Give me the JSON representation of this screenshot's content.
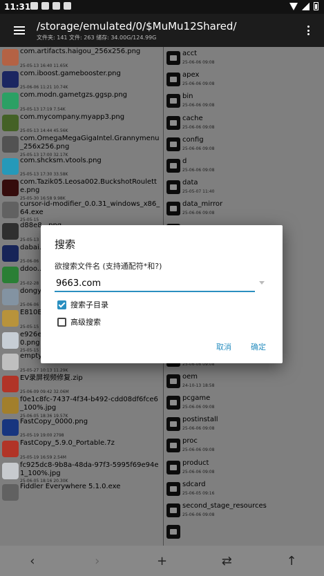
{
  "status_bar": {
    "time": "11:31"
  },
  "header": {
    "path": "/storage/emulated/0/$MuMu12Shared/",
    "stats": "文件夹: 141  文件: 263  储存: 34.00G/124.99G"
  },
  "left_files": [
    {
      "name": "com.artifacts.haigou_256x256.png",
      "meta": "25-05-13 16:40  11.65K",
      "color": "#c46b4a"
    },
    {
      "name": "com.iboost.gamebooster.png",
      "meta": "25-06-06 11:21  10.74K",
      "color": "#1e2a6a"
    },
    {
      "name": "com.modn.gametgzs.ggsp.png",
      "meta": "25-05-13 17:19  7.54K",
      "color": "#2fae6d"
    },
    {
      "name": "com.mycompany.myapp3.png",
      "meta": "25-05-13 14:44  45.56K",
      "color": "#4a6a2a"
    },
    {
      "name": "com.OmegaMegaGigaIntel.Grannymenu_256x256.png",
      "meta": "25-05-13 17:00  32.17K",
      "color": "#5a5a5a"
    },
    {
      "name": "com.shcksm.vtools.png",
      "meta": "25-05-13 17:30  33.58K",
      "color": "#2aa6c9"
    },
    {
      "name": "com.Tazik05.Leosa002.BuckshotRoulette.png",
      "meta": "25-05-30 16:58  9.98K",
      "color": "#3a0e0e"
    },
    {
      "name": "cursor-id-modifier_0.0.31_windows_x86_64.exe",
      "meta": "25-05-15",
      "color": "#6a6a6a"
    },
    {
      "name": "d88e8...png",
      "meta": "25-05-13",
      "color": "#333"
    },
    {
      "name": "dabai...",
      "meta": "25-06-06",
      "color": "#1a2860"
    },
    {
      "name": "ddoo...",
      "meta": "25-02-28",
      "color": "#2e8a3a"
    },
    {
      "name": "dongy...",
      "meta": "25-06-06",
      "color": "#8fa0b0"
    },
    {
      "name": "E810B...",
      "meta": "25-05-15",
      "color": "#c8a040"
    },
    {
      "name": "e926e20f-c6a7-4725-a5ef-b2d7850cfcd0.png",
      "meta": "25-05-15 19:54  1.36K",
      "color": "#d8e0e8"
    },
    {
      "name": "empty.png",
      "meta": "25-05-27 10:13  11.29K",
      "color": "#d0d0d0"
    },
    {
      "name": "EV录屏视频修复.zip",
      "meta": "25-06-09 09:42  32.06M",
      "color": "#c0392b"
    },
    {
      "name": "f0e1c8fc-7437-4f34-b492-cdd08df6fce6_100%.jpg",
      "meta": "25-06-05 18:36  19.57K",
      "color": "#b08a30"
    },
    {
      "name": "FastCopy_0000.png",
      "meta": "25-05-19 19:00  2798",
      "color": "#1a3a8a"
    },
    {
      "name": "FastCopy_5.9.0_Portable.7z",
      "meta": "25-05-19 16:59  2.54M",
      "color": "#c0392b"
    },
    {
      "name": "fc925dc8-9b8a-48da-97f3-5995f69e94e1_100%.jpg",
      "meta": "25-06-05 18:16  20.30K",
      "color": "#d8dce0"
    },
    {
      "name": "Fiddler Everywhere 5.1.0.exe",
      "meta": "",
      "color": "#6a6a6a"
    }
  ],
  "right_folders": [
    {
      "name": "acct",
      "meta": "25-06-06 09:08"
    },
    {
      "name": "apex",
      "meta": "25-06-06 09:08"
    },
    {
      "name": "bin",
      "meta": "25-06-06 09:08"
    },
    {
      "name": "cache",
      "meta": "25-06-06 09:08"
    },
    {
      "name": "config",
      "meta": "25-06-06 09:08"
    },
    {
      "name": "d",
      "meta": "25-06-06 09:08"
    },
    {
      "name": "data",
      "meta": "25-05-07 11:40"
    },
    {
      "name": "data_mirror",
      "meta": "25-06-06 09:08"
    },
    {
      "name": "",
      "meta": ""
    },
    {
      "name": "",
      "meta": ""
    },
    {
      "name": "",
      "meta": ""
    },
    {
      "name": "",
      "meta": ""
    },
    {
      "name": "",
      "meta": ""
    },
    {
      "name": "",
      "meta": "25-06-06 09:08"
    },
    {
      "name": "odm_dlkm",
      "meta": "25-06-06 09:08"
    },
    {
      "name": "oem",
      "meta": "24-10-13 18:58"
    },
    {
      "name": "pcgame",
      "meta": "25-06-06 09:08"
    },
    {
      "name": "postinstall",
      "meta": "25-06-06 09:08"
    },
    {
      "name": "proc",
      "meta": "25-06-06 09:08"
    },
    {
      "name": "product",
      "meta": "25-06-06 09:08"
    },
    {
      "name": "sdcard",
      "meta": "25-06-05 09:16"
    },
    {
      "name": "second_stage_resources",
      "meta": "25-06-06 09:08"
    },
    {
      "name": "",
      "meta": ""
    }
  ],
  "dialog": {
    "title": "搜索",
    "prompt": "欲搜索文件名 (支持通配符*和?)",
    "query": "9663.com",
    "subdir_label": "搜索子目录",
    "subdir_checked": true,
    "advanced_label": "高级搜索",
    "advanced_checked": false,
    "cancel_label": "取消",
    "ok_label": "确定"
  },
  "bottom_bar": {
    "back": "‹",
    "forward": "›",
    "add": "+",
    "swap": "⇄",
    "up": "↑"
  }
}
